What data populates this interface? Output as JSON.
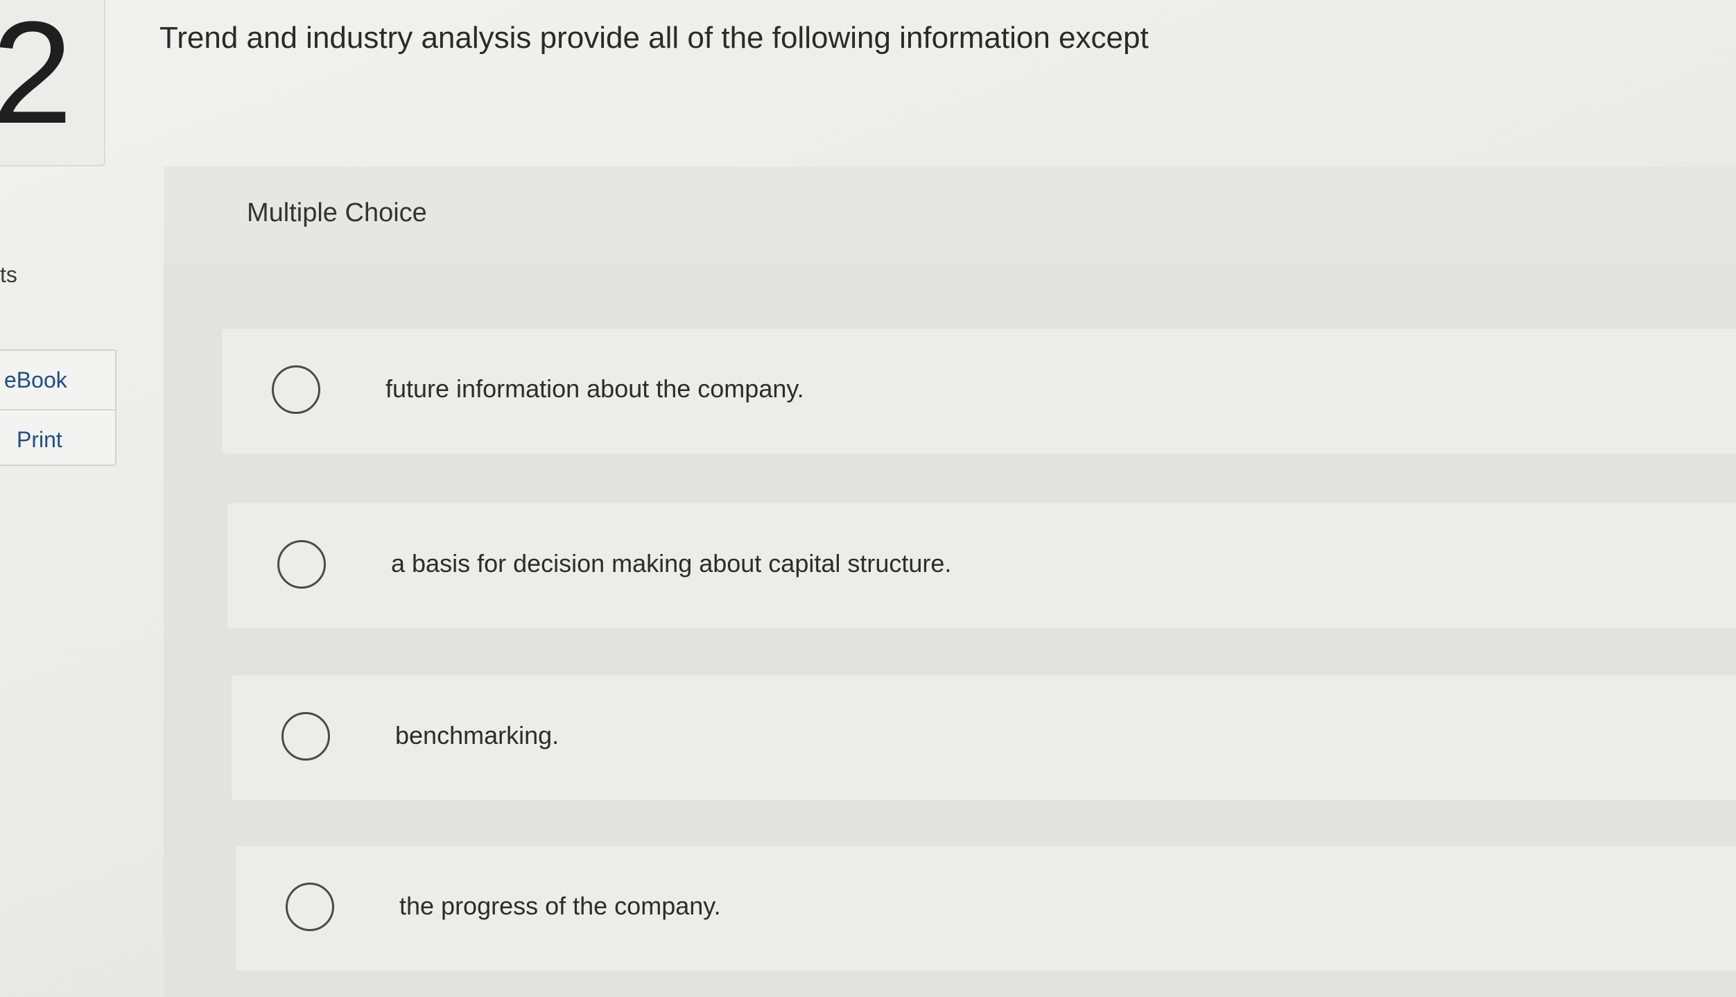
{
  "question": {
    "number": "2",
    "points_label": "ts",
    "text": "Trend and industry analysis provide all of the following information except"
  },
  "resources": {
    "ebook_label": "eBook",
    "print_label": "Print"
  },
  "answer": {
    "type_label": "Multiple Choice",
    "choices": [
      {
        "label": "future information about the company."
      },
      {
        "label": "a basis for decision making about capital structure."
      },
      {
        "label": "benchmarking."
      },
      {
        "label": "the progress of the company."
      }
    ]
  }
}
